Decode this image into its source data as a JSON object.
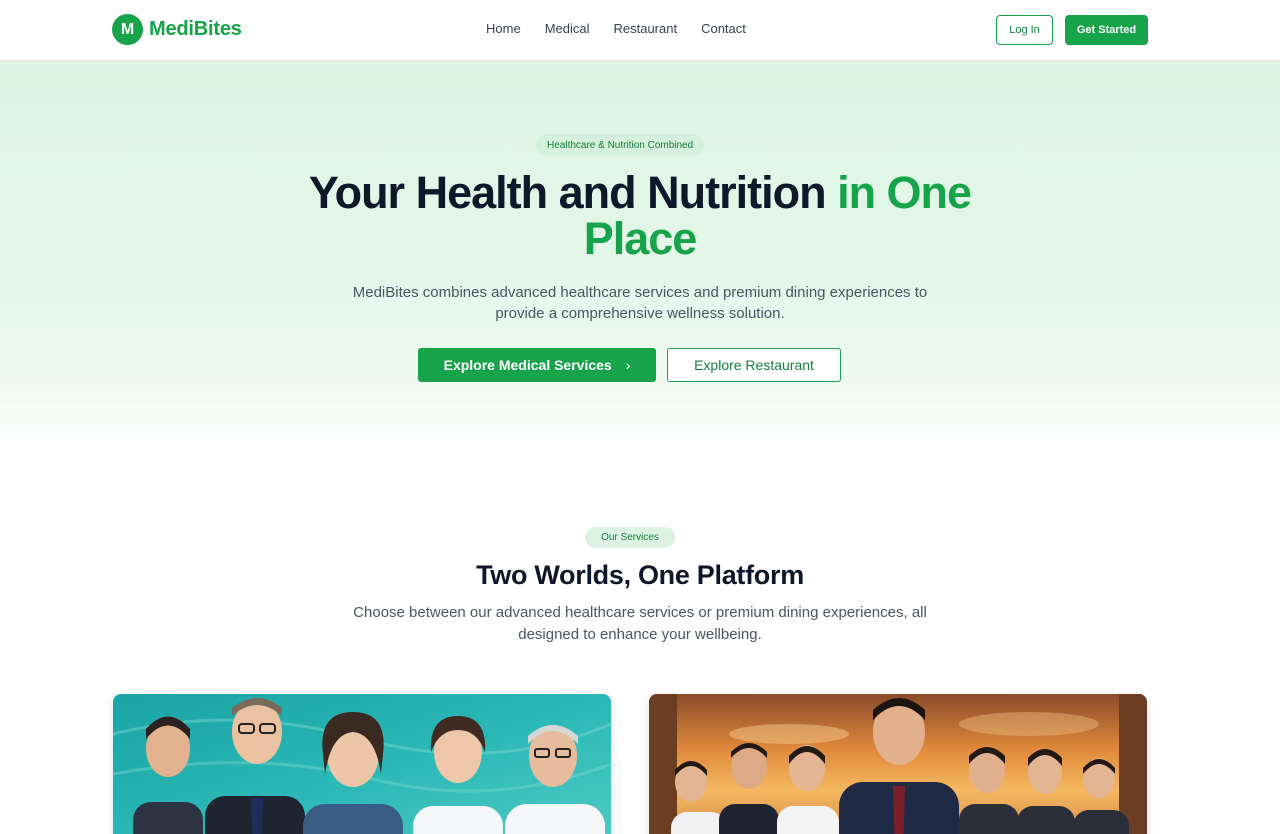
{
  "brand": {
    "logo_letter": "M",
    "name": "MediBites",
    "color": "#16a34a"
  },
  "nav": {
    "items": [
      "Home",
      "Medical",
      "Restaurant",
      "Contact"
    ]
  },
  "header": {
    "login_label": "Log In",
    "get_started_label": "Get Started"
  },
  "hero": {
    "badge": "Healthcare & Nutrition Combined",
    "title_main": "Your Health and Nutrition ",
    "title_accent": "in One Place",
    "subtitle": "MediBites combines advanced healthcare services and premium dining experiences to provide a comprehensive wellness solution.",
    "primary_cta": "Explore Medical Services",
    "primary_cta_icon": "chevron-right-icon",
    "secondary_cta": "Explore Restaurant"
  },
  "services": {
    "badge": "Our Services",
    "title": "Two Worlds, One Platform",
    "subtitle": "Choose between our advanced healthcare services or premium dining experiences, all designed to enhance your wellbeing."
  },
  "cards": [
    {
      "id": "medical",
      "image": "medical-team-illustration"
    },
    {
      "id": "restaurant",
      "image": "restaurant-staff-illustration"
    }
  ]
}
